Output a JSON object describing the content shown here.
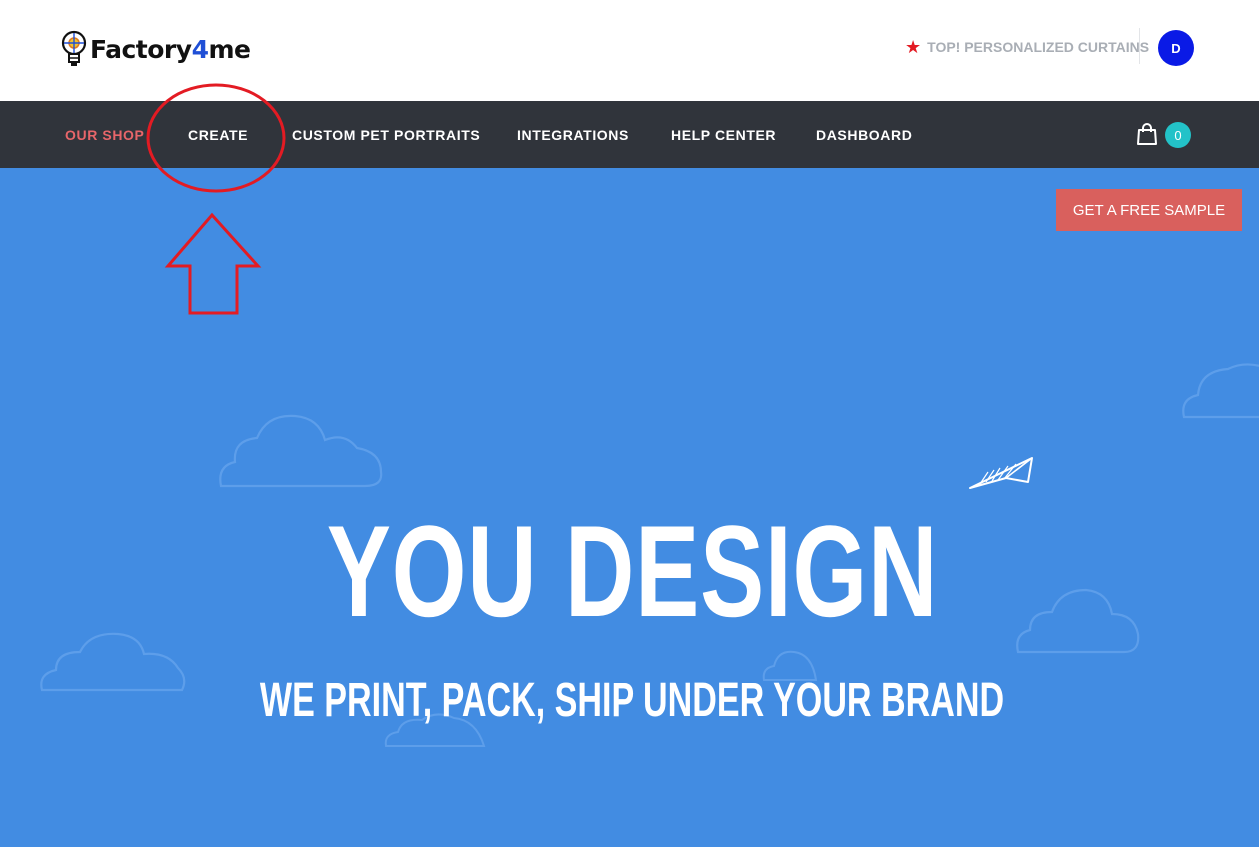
{
  "header": {
    "logo_text_before": "Factory",
    "logo_text_four": "4",
    "logo_text_after": "me",
    "promo_text": "TOP! PERSONALIZED CURTAINS",
    "avatar_initial": "D"
  },
  "nav": {
    "items": [
      {
        "label": "OUR SHOP",
        "active": true
      },
      {
        "label": "CREATE",
        "active": false
      },
      {
        "label": "CUSTOM PET PORTRAITS",
        "active": false
      },
      {
        "label": "INTEGRATIONS",
        "active": false
      },
      {
        "label": "HELP CENTER",
        "active": false
      },
      {
        "label": "DASHBOARD",
        "active": false
      }
    ],
    "cart_count": "0"
  },
  "hero": {
    "sample_button": "GET A FREE SAMPLE",
    "title": "YOU DESIGN",
    "subtitle": "WE PRINT, PACK, SHIP UNDER YOUR BRAND"
  },
  "colors": {
    "hero_bg": "#428ce2",
    "nav_bg": "#30343b",
    "active_nav": "#e8666a",
    "sample_button": "#d9605d",
    "cart_badge": "#23c2c8",
    "avatar": "#0a1ae6",
    "annotation": "#e31b23"
  },
  "icons": [
    "lightbulb-logo-icon",
    "star-icon",
    "shopping-bag-icon",
    "paper-plane-icon",
    "cloud-icon"
  ]
}
